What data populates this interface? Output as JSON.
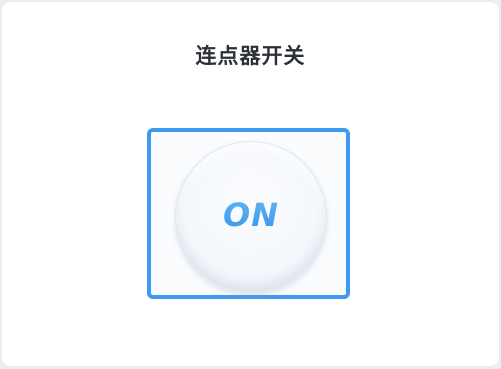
{
  "title": "连点器开关",
  "toggle": {
    "label": "ON",
    "state": "on"
  },
  "colors": {
    "accent": "#3d9bef",
    "label_gradient_top": "#5fb6f6",
    "label_gradient_bottom": "#3b95ea",
    "title_text": "#2b2f36",
    "background": "#ffffff"
  }
}
